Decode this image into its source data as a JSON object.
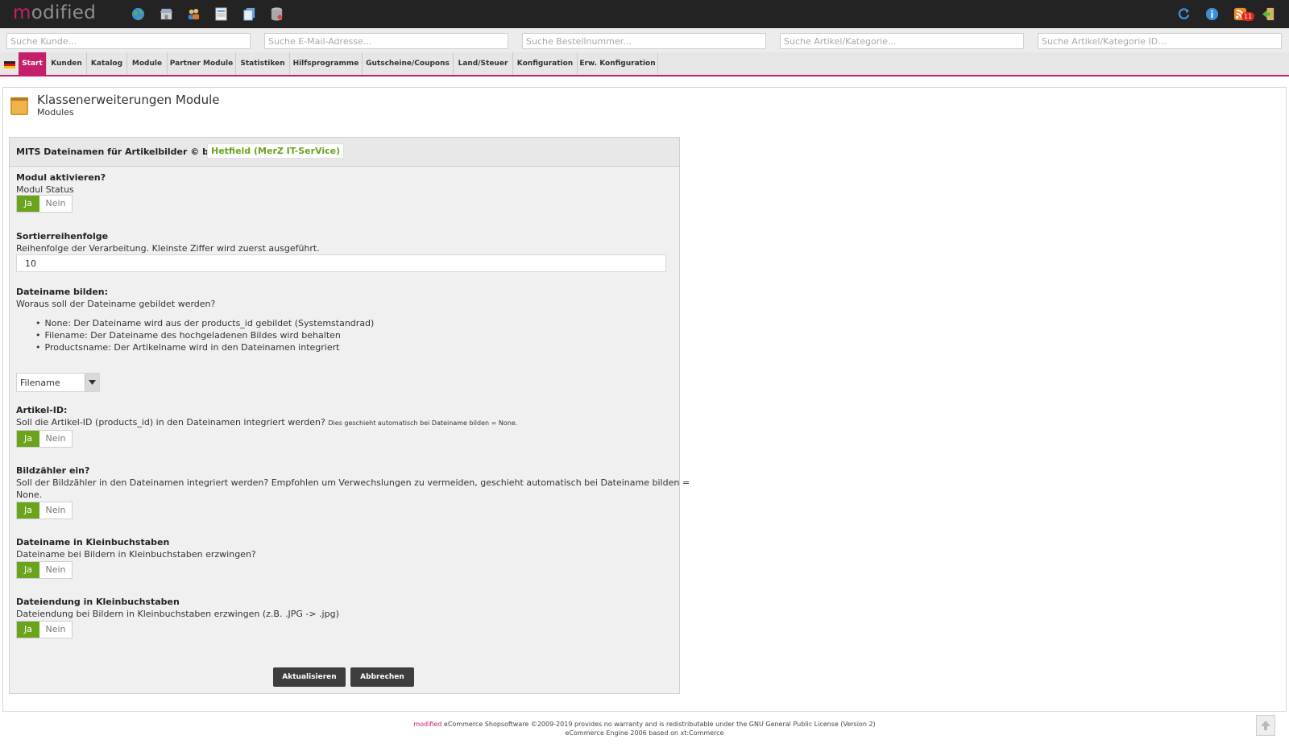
{
  "logo": {
    "first": "m",
    "rest": "odified"
  },
  "toolbar": {
    "left_icons": [
      "globe-icon",
      "shop-icon",
      "users-icon",
      "document-icon",
      "copy-icon",
      "database-icon"
    ],
    "right_icons": [
      "refresh-icon",
      "info-icon",
      "rss-icon",
      "logout-icon"
    ],
    "rss_badge": "11"
  },
  "search": {
    "customer": "Suche Kunde...",
    "email": "Suche E-Mail-Adresse...",
    "order": "Suche Bestellnummer...",
    "product": "Suche Artikel/Kategorie...",
    "product_id": "Suche Artikel/Kategorie ID..."
  },
  "menu": {
    "items": [
      {
        "label": "Start",
        "active": true
      },
      {
        "label": "Kunden"
      },
      {
        "label": "Katalog"
      },
      {
        "label": "Module"
      },
      {
        "label": "Partner Module"
      },
      {
        "label": "Statistiken"
      },
      {
        "label": "Hilfsprogramme"
      },
      {
        "label": "Gutscheine/Coupons"
      },
      {
        "label": "Land/Steuer"
      },
      {
        "label": "Konfiguration"
      },
      {
        "label": "Erw. Konfiguration"
      }
    ]
  },
  "page": {
    "title": "Klassenerweiterungen Module",
    "subtitle": "Modules"
  },
  "module": {
    "title": "MITS Dateinamen für Artikelbilder © by",
    "author_link": "Hetfield (MerZ IT-SerVice)",
    "toggle_yes": "Ja",
    "toggle_no": "Nein",
    "status": {
      "label": "Modul aktivieren?",
      "desc": "Modul Status",
      "value": "Ja"
    },
    "sort": {
      "label": "Sortierreihenfolge",
      "desc": "Reihenfolge der Verarbeitung. Kleinste Ziffer wird zuerst ausgeführt.",
      "value": "10"
    },
    "filename": {
      "label": "Dateiname bilden:",
      "desc": "Woraus soll der Dateiname gebildet werden?",
      "options": [
        "None: Der Dateiname wird aus der products_id gebildet (Systemstandrad)",
        "Filename: Der Dateiname des hochgeladenen Bildes wird behalten",
        "Productsname: Der Artikelname wird in den Dateinamen integriert"
      ],
      "selected": "Filename"
    },
    "article_id": {
      "label": "Artikel-ID:",
      "desc": "Soll die Artikel-ID (products_id) in den Dateinamen integriert werden?",
      "note": "Dies geschieht automatisch bei Dateiname bilden = None.",
      "value": "Ja"
    },
    "counter": {
      "label": "Bildzähler ein?",
      "desc_line1": "Soll der Bildzähler in den Dateinamen integriert werden? Empfohlen um Verwechslungen zu vermeiden, geschieht automatisch bei Dateiname bilden =",
      "desc_line2": "None.",
      "value": "Ja"
    },
    "lowercase_name": {
      "label": "Dateiname in Kleinbuchstaben",
      "desc": "Dateiname bei Bildern in Kleinbuchstaben erzwingen?",
      "value": "Ja"
    },
    "lowercase_ext": {
      "label": "Dateiendung in Kleinbuchstaben",
      "desc": "Dateiendung bei Bildern in Kleinbuchstaben erzwingen (z.B. .JPG -> .jpg)",
      "value": "Ja"
    },
    "buttons": {
      "update": "Aktualisieren",
      "cancel": "Abbrechen"
    }
  },
  "footer": {
    "brand": "modified",
    "line1": " eCommerce Shopsoftware ©2009-2019 provides no warranty and is redistributable under the GNU General Public License (Version 2)",
    "line2": "eCommerce Engine 2006 based on xt:Commerce"
  },
  "colors": {
    "brand": "#c51e6b",
    "accent_green": "#6aa31c",
    "topbar": "#232323"
  }
}
